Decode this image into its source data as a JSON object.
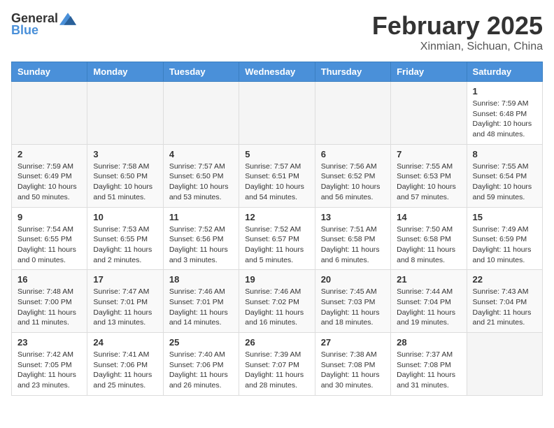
{
  "header": {
    "logo_general": "General",
    "logo_blue": "Blue",
    "month_year": "February 2025",
    "location": "Xinmian, Sichuan, China"
  },
  "days_of_week": [
    "Sunday",
    "Monday",
    "Tuesday",
    "Wednesday",
    "Thursday",
    "Friday",
    "Saturday"
  ],
  "weeks": [
    [
      {
        "day": "",
        "info": ""
      },
      {
        "day": "",
        "info": ""
      },
      {
        "day": "",
        "info": ""
      },
      {
        "day": "",
        "info": ""
      },
      {
        "day": "",
        "info": ""
      },
      {
        "day": "",
        "info": ""
      },
      {
        "day": "1",
        "info": "Sunrise: 7:59 AM\nSunset: 6:48 PM\nDaylight: 10 hours\nand 48 minutes."
      }
    ],
    [
      {
        "day": "2",
        "info": "Sunrise: 7:59 AM\nSunset: 6:49 PM\nDaylight: 10 hours\nand 50 minutes."
      },
      {
        "day": "3",
        "info": "Sunrise: 7:58 AM\nSunset: 6:50 PM\nDaylight: 10 hours\nand 51 minutes."
      },
      {
        "day": "4",
        "info": "Sunrise: 7:57 AM\nSunset: 6:50 PM\nDaylight: 10 hours\nand 53 minutes."
      },
      {
        "day": "5",
        "info": "Sunrise: 7:57 AM\nSunset: 6:51 PM\nDaylight: 10 hours\nand 54 minutes."
      },
      {
        "day": "6",
        "info": "Sunrise: 7:56 AM\nSunset: 6:52 PM\nDaylight: 10 hours\nand 56 minutes."
      },
      {
        "day": "7",
        "info": "Sunrise: 7:55 AM\nSunset: 6:53 PM\nDaylight: 10 hours\nand 57 minutes."
      },
      {
        "day": "8",
        "info": "Sunrise: 7:55 AM\nSunset: 6:54 PM\nDaylight: 10 hours\nand 59 minutes."
      }
    ],
    [
      {
        "day": "9",
        "info": "Sunrise: 7:54 AM\nSunset: 6:55 PM\nDaylight: 11 hours\nand 0 minutes."
      },
      {
        "day": "10",
        "info": "Sunrise: 7:53 AM\nSunset: 6:55 PM\nDaylight: 11 hours\nand 2 minutes."
      },
      {
        "day": "11",
        "info": "Sunrise: 7:52 AM\nSunset: 6:56 PM\nDaylight: 11 hours\nand 3 minutes."
      },
      {
        "day": "12",
        "info": "Sunrise: 7:52 AM\nSunset: 6:57 PM\nDaylight: 11 hours\nand 5 minutes."
      },
      {
        "day": "13",
        "info": "Sunrise: 7:51 AM\nSunset: 6:58 PM\nDaylight: 11 hours\nand 6 minutes."
      },
      {
        "day": "14",
        "info": "Sunrise: 7:50 AM\nSunset: 6:58 PM\nDaylight: 11 hours\nand 8 minutes."
      },
      {
        "day": "15",
        "info": "Sunrise: 7:49 AM\nSunset: 6:59 PM\nDaylight: 11 hours\nand 10 minutes."
      }
    ],
    [
      {
        "day": "16",
        "info": "Sunrise: 7:48 AM\nSunset: 7:00 PM\nDaylight: 11 hours\nand 11 minutes."
      },
      {
        "day": "17",
        "info": "Sunrise: 7:47 AM\nSunset: 7:01 PM\nDaylight: 11 hours\nand 13 minutes."
      },
      {
        "day": "18",
        "info": "Sunrise: 7:46 AM\nSunset: 7:01 PM\nDaylight: 11 hours\nand 14 minutes."
      },
      {
        "day": "19",
        "info": "Sunrise: 7:46 AM\nSunset: 7:02 PM\nDaylight: 11 hours\nand 16 minutes."
      },
      {
        "day": "20",
        "info": "Sunrise: 7:45 AM\nSunset: 7:03 PM\nDaylight: 11 hours\nand 18 minutes."
      },
      {
        "day": "21",
        "info": "Sunrise: 7:44 AM\nSunset: 7:04 PM\nDaylight: 11 hours\nand 19 minutes."
      },
      {
        "day": "22",
        "info": "Sunrise: 7:43 AM\nSunset: 7:04 PM\nDaylight: 11 hours\nand 21 minutes."
      }
    ],
    [
      {
        "day": "23",
        "info": "Sunrise: 7:42 AM\nSunset: 7:05 PM\nDaylight: 11 hours\nand 23 minutes."
      },
      {
        "day": "24",
        "info": "Sunrise: 7:41 AM\nSunset: 7:06 PM\nDaylight: 11 hours\nand 25 minutes."
      },
      {
        "day": "25",
        "info": "Sunrise: 7:40 AM\nSunset: 7:06 PM\nDaylight: 11 hours\nand 26 minutes."
      },
      {
        "day": "26",
        "info": "Sunrise: 7:39 AM\nSunset: 7:07 PM\nDaylight: 11 hours\nand 28 minutes."
      },
      {
        "day": "27",
        "info": "Sunrise: 7:38 AM\nSunset: 7:08 PM\nDaylight: 11 hours\nand 30 minutes."
      },
      {
        "day": "28",
        "info": "Sunrise: 7:37 AM\nSunset: 7:08 PM\nDaylight: 11 hours\nand 31 minutes."
      },
      {
        "day": "",
        "info": ""
      }
    ]
  ]
}
